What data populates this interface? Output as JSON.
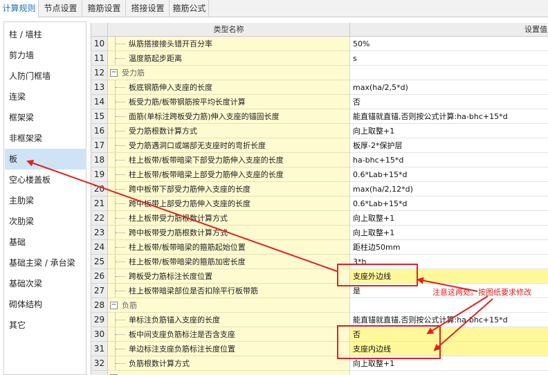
{
  "tabs": [
    {
      "label": "计算规则",
      "active": true
    },
    {
      "label": "节点设置",
      "active": false
    },
    {
      "label": "箍筋设置",
      "active": false
    },
    {
      "label": "搭接设置",
      "active": false
    },
    {
      "label": "箍筋公式",
      "active": false
    }
  ],
  "sidebar": {
    "items": [
      {
        "label": "柱 / 墙柱"
      },
      {
        "label": "剪力墙"
      },
      {
        "label": "人防门框墙"
      },
      {
        "label": "连梁"
      },
      {
        "label": "框架梁"
      },
      {
        "label": "非框架梁"
      },
      {
        "label": "板",
        "selected": true
      },
      {
        "label": "空心楼盖板"
      },
      {
        "label": "主肋梁"
      },
      {
        "label": "次肋梁"
      },
      {
        "label": "基础"
      },
      {
        "label": "基础主梁 / 承台梁"
      },
      {
        "label": "基础次梁"
      },
      {
        "label": "砌体结构"
      },
      {
        "label": "其它"
      }
    ]
  },
  "grid": {
    "header_name": "类型名称",
    "header_value": "设置值",
    "rows": [
      {
        "num": "10",
        "name": "纵筋搭接接头错开百分率",
        "value": "50%"
      },
      {
        "num": "11",
        "name": "温度筋起步距离",
        "value": "s"
      },
      {
        "num": "12",
        "name": "受力筋",
        "group": true,
        "value": ""
      },
      {
        "num": "13",
        "name": "板底钢筋伸入支座的长度",
        "value": "max(ha/2,5*d)"
      },
      {
        "num": "14",
        "name": "板受力筋/板带钢筋按平均长度计算",
        "value": "否"
      },
      {
        "num": "15",
        "name": "面筋(单标注跨板受力筋)伸入支座的锚固长度",
        "value": "能直锚就直锚,否则按公式计算:ha-bhc+15*d"
      },
      {
        "num": "16",
        "name": "受力筋根数计算方式",
        "value": "向上取整+1"
      },
      {
        "num": "17",
        "name": "受力筋遇洞口或端部无支座时的弯折长度",
        "value": "板厚-2*保护层"
      },
      {
        "num": "18",
        "name": "柱上板带/板带暗梁下部受力筋伸入支座的长度",
        "value": "ha-bhc+15*d"
      },
      {
        "num": "19",
        "name": "柱上板带/板带暗梁上部受力筋伸入支座的长度",
        "value": "0.6*Lab+15*d"
      },
      {
        "num": "20",
        "name": "跨中板带下部受力筋伸入支座的长度",
        "value": "max(ha/2,12*d)"
      },
      {
        "num": "21",
        "name": "跨中板带上部受力筋伸入支座的长度",
        "value": "0.6*Lab+15*d"
      },
      {
        "num": "22",
        "name": "柱上板带受力筋根数计算方式",
        "value": "向上取整+1"
      },
      {
        "num": "23",
        "name": "跨中板带受力筋根数计算方式",
        "value": "向上取整+1"
      },
      {
        "num": "24",
        "name": "柱上板带/板带暗梁的箍筋起始位置",
        "value": "距柱边50mm"
      },
      {
        "num": "25",
        "name": "柱上板带/板带暗梁的箍筋加密长度",
        "value": "3*h"
      },
      {
        "num": "26",
        "name": "跨板受力筋标注长度位置",
        "value": "支座外边线",
        "highlight": true
      },
      {
        "num": "27",
        "name": "柱上板带暗梁部位是否扣除平行板带筋",
        "value": "是"
      },
      {
        "num": "28",
        "name": "负筋",
        "group": true,
        "value": ""
      },
      {
        "num": "29",
        "name": "单标注负筋锚入支座的长度",
        "value": "能直锚就直锚,否则按公式计算:ha-bhc+15*d"
      },
      {
        "num": "30",
        "name": "板中间支座负筋标注是否含支座",
        "value": "否",
        "highlight": true
      },
      {
        "num": "31",
        "name": "单边标注支座负筋标注长度位置",
        "value": "支座内边线",
        "highlight": true
      },
      {
        "num": "32",
        "name": "负筋根数计算方式",
        "value": "向上取整+1"
      }
    ]
  },
  "annotation": {
    "note": "注意这两处。按图纸要求修改",
    "color": "#e02020"
  },
  "colors": {
    "name_cell_bg": "#fffbd0",
    "highlight_bg": "#fff89a",
    "selected_bg": "#cfe3f7",
    "active_tab_text": "#1a6fc0"
  }
}
